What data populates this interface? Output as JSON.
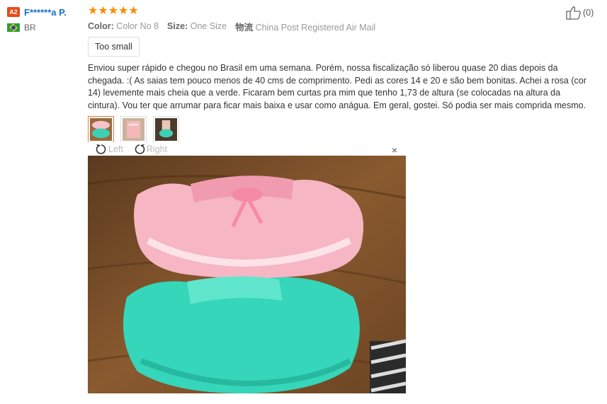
{
  "user": {
    "badge": "A2",
    "name": "F******a P.",
    "country": "BR"
  },
  "rating": {
    "stars": 5
  },
  "attributes": [
    {
      "label": "Color:",
      "value": "Color No 8"
    },
    {
      "label": "Size:",
      "value": "One Size"
    },
    {
      "label": "物流",
      "value": "China Post Registered Air Mail"
    }
  ],
  "tag": "Too small",
  "review_text": "Enviou super rápido e chegou no Brasil em uma semana. Porém, nossa fiscalização só liberou quase 20 dias depois da chegada. :( As saias tem pouco menos de 40 cms de comprimento. Pedi as cores 14 e 20 e são bem bonitas. Achei a rosa (cor 14) levemente mais cheia que a verde. Ficaram bem curtas pra mim que tenho 1,73 de altura (se colocadas na altura da cintura). Vou ter que arrumar para ficar mais baixa e usar como anágua. Em geral, gostei. Só podia ser mais comprida mesmo.",
  "viewer": {
    "left_label": "Left",
    "right_label": "Right",
    "close": "×"
  },
  "helpful": {
    "count": "(0)"
  },
  "colors": {
    "accent": "#e8773b",
    "star": "#ff8a00",
    "link": "#1a6fc9"
  }
}
